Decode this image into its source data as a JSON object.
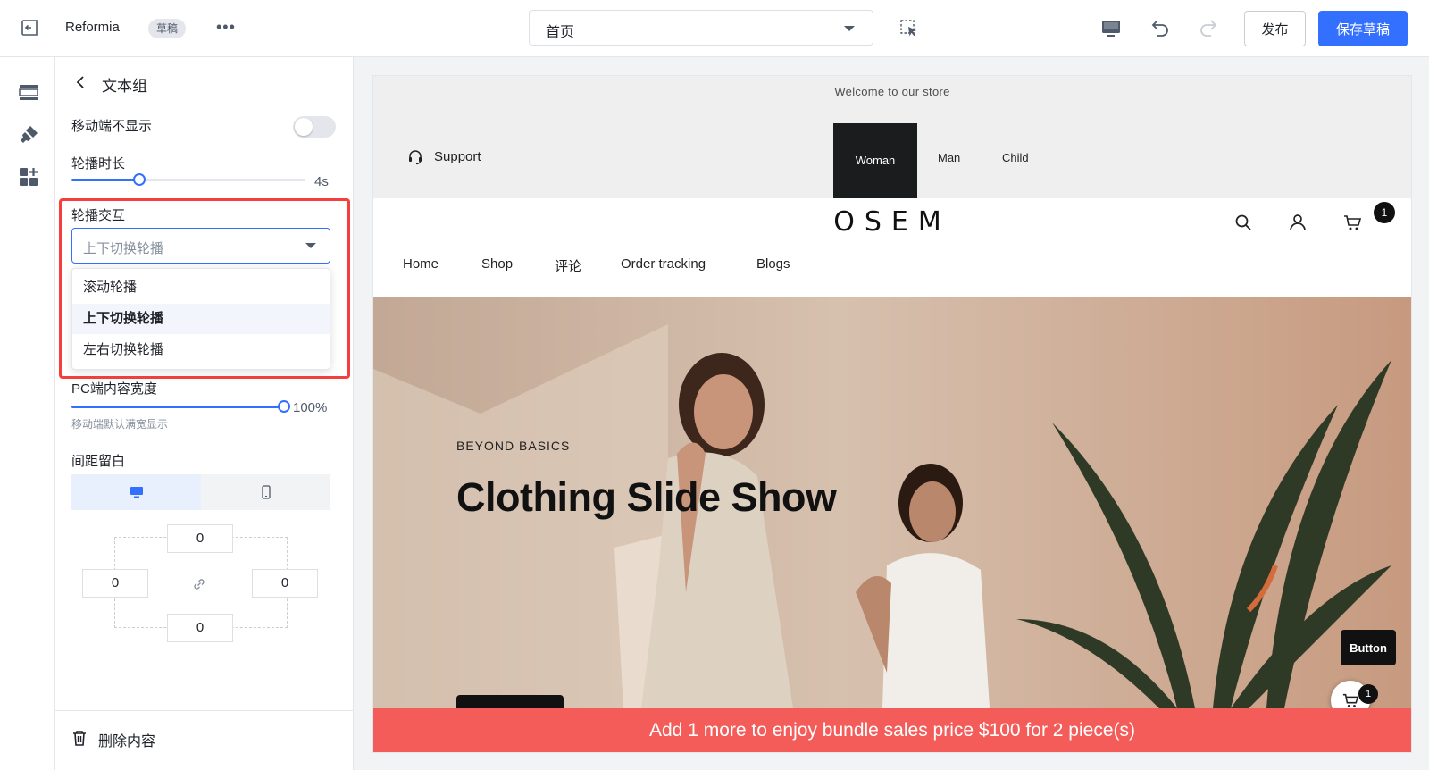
{
  "topbar": {
    "app_name": "Reformia",
    "draft_badge": "草稿",
    "more": "•••",
    "page_select": "首页",
    "publish_label": "发布",
    "save_label": "保存草稿"
  },
  "rail": {
    "icons": [
      "sections-icon",
      "theme-brush-icon",
      "add-widget-icon"
    ]
  },
  "panel": {
    "title": "文本组",
    "hide_mobile_label": "移动端不显示",
    "hide_mobile_on": false,
    "duration_label": "轮播时长",
    "duration_value": "4s",
    "duration_fraction": 0.29,
    "interaction_label": "轮播交互",
    "interaction_placeholder": "上下切换轮播",
    "interaction_options": [
      "滚动轮播",
      "上下切换轮播",
      "左右切换轮播"
    ],
    "interaction_selected": "上下切换轮播",
    "pc_width_label": "PC端内容宽度",
    "pc_width_value": "100%",
    "pc_width_fraction": 1.0,
    "mobile_hint": "移动端默认满宽显示",
    "spacing_label": "间距留白",
    "spacing": {
      "top": "0",
      "left": "0",
      "right": "0",
      "bottom": "0"
    },
    "delete_label": "删除内容",
    "highlight_color": "#f53f3f",
    "accent_color": "#3370ff"
  },
  "preview": {
    "welcome": "Welcome to our store",
    "support": "Support",
    "categories": [
      "Woman",
      "Man",
      "Child"
    ],
    "logo": "OSEM",
    "cart_count": "1",
    "nav": [
      "Home",
      "Shop",
      "评论",
      "Order tracking",
      "Blogs"
    ],
    "hero_kicker": "BEYOND BASICS",
    "hero_title": "Clothing Slide Show",
    "float_button": "Button",
    "float_cart_count": "1",
    "promo": "Add 1 more to enjoy bundle sales price $100 for 2 piece(s)",
    "promo_color": "#f35c58"
  }
}
